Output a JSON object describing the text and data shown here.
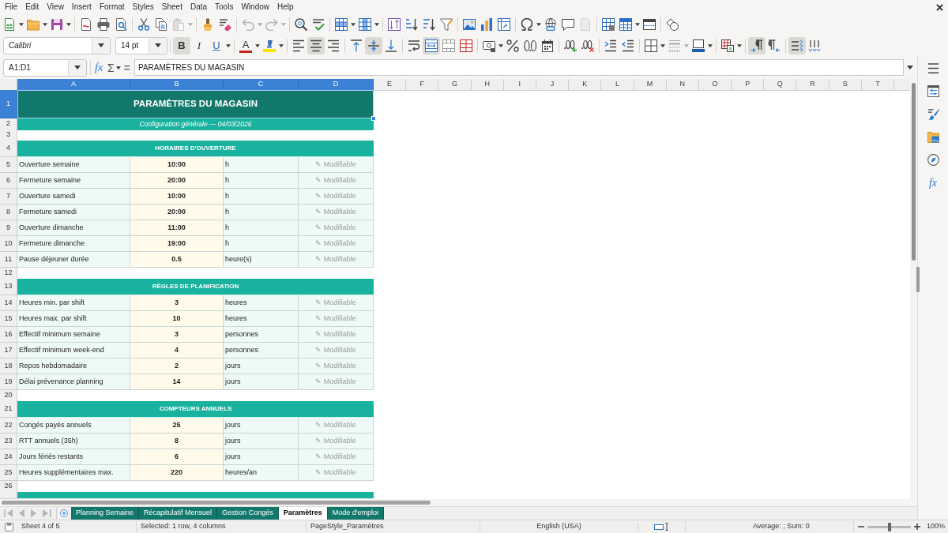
{
  "menu_bar": {
    "items": [
      "File",
      "Edit",
      "View",
      "Insert",
      "Format",
      "Styles",
      "Sheet",
      "Data",
      "Tools",
      "Window",
      "Help"
    ]
  },
  "standard_toolbar": {
    "paste_disabled": true,
    "undo_disabled": true,
    "redo_disabled": true,
    "headers_footers_disabled": true
  },
  "formatting_toolbar": {
    "font_name": "Calibri",
    "font_size": "14 pt",
    "bold_glyph": "B",
    "bold": true,
    "italic_glyph": "I",
    "italic": false,
    "underline_glyph": "U",
    "underline": false,
    "font_color_glyph": "A",
    "align_left": false,
    "align_center": true,
    "align_right": false,
    "align_top": false,
    "align_middle": true,
    "align_bottom": false,
    "wrap_text": false,
    "merge_and_center": true,
    "merge_cells": false,
    "paragraph_left_to_right": true,
    "paragraph_right_to_left": false,
    "text_horizontal": true,
    "text_vertical": false
  },
  "formula_bar": {
    "name_box": "A1:D1",
    "function_wizard_glyph": "fx",
    "sum_glyph": "Σ",
    "equals_glyph": "=",
    "content": "PARAMÈTRES DU MAGASIN"
  },
  "sheet": {
    "columns": [
      {
        "label": "A",
        "selected": true
      },
      {
        "label": "B",
        "selected": true
      },
      {
        "label": "C",
        "selected": true
      },
      {
        "label": "D",
        "selected": true
      },
      {
        "label": "E",
        "selected": false
      },
      {
        "label": "F",
        "selected": false
      },
      {
        "label": "G",
        "selected": false
      },
      {
        "label": "H",
        "selected": false
      },
      {
        "label": "I",
        "selected": false
      },
      {
        "label": "J",
        "selected": false
      },
      {
        "label": "K",
        "selected": false
      },
      {
        "label": "L",
        "selected": false
      },
      {
        "label": "M",
        "selected": false
      },
      {
        "label": "N",
        "selected": false
      },
      {
        "label": "O",
        "selected": false
      },
      {
        "label": "P",
        "selected": false
      },
      {
        "label": "Q",
        "selected": false
      },
      {
        "label": "R",
        "selected": false
      },
      {
        "label": "S",
        "selected": false
      },
      {
        "label": "T",
        "selected": false
      }
    ],
    "rows": [
      {
        "number": "1",
        "selected": true,
        "kind": "title",
        "text": "PARAMÈTRES DU MAGASIN"
      },
      {
        "number": "2",
        "selected": false,
        "kind": "subtitle",
        "text": "Configuration générale — 04/03/2026"
      },
      {
        "number": "3",
        "selected": false,
        "kind": "blank"
      },
      {
        "number": "4",
        "selected": false,
        "kind": "section",
        "text": "HORAIRES D'OUVERTURE"
      },
      {
        "number": "5",
        "selected": false,
        "kind": "parameter",
        "label": "Ouverture semaine",
        "value": "10:00",
        "unit": "h",
        "note": "✎ Modifiable"
      },
      {
        "number": "6",
        "selected": false,
        "kind": "parameter",
        "label": "Fermeture semaine",
        "value": "20:00",
        "unit": "h",
        "note": "✎ Modifiable"
      },
      {
        "number": "7",
        "selected": false,
        "kind": "parameter",
        "label": "Ouverture samedi",
        "value": "10:00",
        "unit": "h",
        "note": "✎ Modifiable"
      },
      {
        "number": "8",
        "selected": false,
        "kind": "parameter",
        "label": "Fermeture samedi",
        "value": "20:00",
        "unit": "h",
        "note": "✎ Modifiable"
      },
      {
        "number": "9",
        "selected": false,
        "kind": "parameter",
        "label": "Ouverture dimanche",
        "value": "11:00",
        "unit": "h",
        "note": "✎ Modifiable"
      },
      {
        "number": "10",
        "selected": false,
        "kind": "parameter",
        "label": "Fermeture dimanche",
        "value": "19:00",
        "unit": "h",
        "note": "✎ Modifiable"
      },
      {
        "number": "11",
        "selected": false,
        "kind": "parameter",
        "label": "Pause déjeuner durée",
        "value": "0.5",
        "unit": "heure(s)",
        "note": "✎ Modifiable"
      },
      {
        "number": "12",
        "selected": false,
        "kind": "blank"
      },
      {
        "number": "13",
        "selected": false,
        "kind": "section",
        "text": "RÈGLES DE PLANIFICATION"
      },
      {
        "number": "14",
        "selected": false,
        "kind": "parameter",
        "label": "Heures min. par shift",
        "value": "3",
        "unit": "heures",
        "note": "✎ Modifiable"
      },
      {
        "number": "15",
        "selected": false,
        "kind": "parameter",
        "label": "Heures max. par shift",
        "value": "10",
        "unit": "heures",
        "note": "✎ Modifiable"
      },
      {
        "number": "16",
        "selected": false,
        "kind": "parameter",
        "label": "Effectif minimum semaine",
        "value": "3",
        "unit": "personnes",
        "note": "✎ Modifiable"
      },
      {
        "number": "17",
        "selected": false,
        "kind": "parameter",
        "label": "Effectif minimum week-end",
        "value": "4",
        "unit": "personnes",
        "note": "✎ Modifiable"
      },
      {
        "number": "18",
        "selected": false,
        "kind": "parameter",
        "label": "Repos hebdomadaire",
        "value": "2",
        "unit": "jours",
        "note": "✎ Modifiable"
      },
      {
        "number": "19",
        "selected": false,
        "kind": "parameter",
        "label": "Délai prévenance planning",
        "value": "14",
        "unit": "jours",
        "note": "✎ Modifiable"
      },
      {
        "number": "20",
        "selected": false,
        "kind": "blank"
      },
      {
        "number": "21",
        "selected": false,
        "kind": "section",
        "text": "COMPTEURS ANNUELS"
      },
      {
        "number": "22",
        "selected": false,
        "kind": "parameter",
        "label": "Congés payés annuels",
        "value": "25",
        "unit": "jours",
        "note": "✎ Modifiable"
      },
      {
        "number": "23",
        "selected": false,
        "kind": "parameter",
        "label": "RTT annuels (35h)",
        "value": "8",
        "unit": "jours",
        "note": "✎ Modifiable"
      },
      {
        "number": "24",
        "selected": false,
        "kind": "parameter",
        "label": "Jours fériés restants",
        "value": "6",
        "unit": "jours",
        "note": "✎ Modifiable"
      },
      {
        "number": "25",
        "selected": false,
        "kind": "parameter",
        "label": "Heures supplémentaires max.",
        "value": "220",
        "unit": "heures/an",
        "note": "✎ Modifiable"
      },
      {
        "number": "26",
        "selected": false,
        "kind": "blank"
      },
      {
        "selected": false,
        "kind": "section"
      }
    ]
  },
  "sheet_tabs": [
    {
      "label": "Planning Semaine",
      "selected": false
    },
    {
      "label": "Récapitulatif Mensuel",
      "selected": false
    },
    {
      "label": "Gestion Congés",
      "selected": false
    },
    {
      "label": "Paramètres",
      "selected": true
    },
    {
      "label": "Mode d'emploi",
      "selected": false
    }
  ],
  "sidebar": {
    "functions_glyph": "fx"
  },
  "status_bar": {
    "sheet_position": "Sheet 4 of 5",
    "selection": "Selected: 1 row, 4 columns",
    "page_style": "PageStyle_Paramètres",
    "language": "English (USA)",
    "summary": "Average: ; Sum: 0",
    "zoom_slider": {
      "level": 0.5
    },
    "zoom": "100%"
  }
}
